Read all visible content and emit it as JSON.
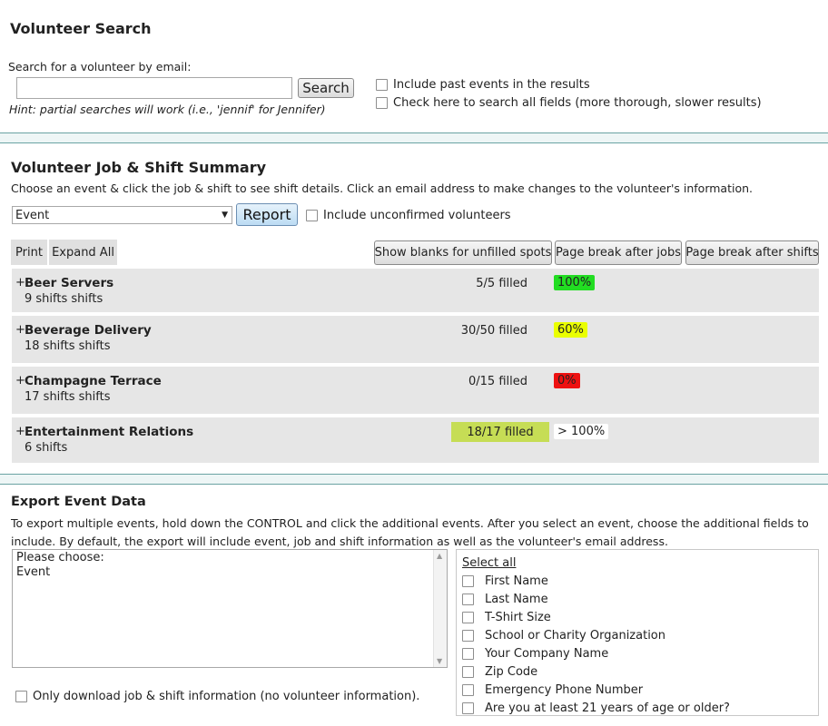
{
  "search": {
    "title": "Volunteer Search",
    "label": "Search for a volunteer by email:",
    "input_value": "",
    "button": "Search",
    "hint": "Hint: partial searches will work (i.e., 'jennif' for Jennifer)",
    "option_past": "Include past events in the results",
    "option_all_fields": "Check here to search all fields (more thorough, slower results)"
  },
  "summary": {
    "title": "Volunteer Job & Shift Summary",
    "instructions": "Choose an event & click the job & shift to see shift details. Click an email address to make changes to the volunteer's information.",
    "event_select": "Event",
    "report_button": "Report",
    "include_unconfirmed": "Include unconfirmed volunteers",
    "print": "Print",
    "expand_all": "Expand All",
    "show_blanks": "Show blanks for unfilled spots",
    "page_break_jobs": "Page break after jobs",
    "page_break_shifts": "Page break after shifts",
    "expander": "+",
    "jobs": [
      {
        "name": "Beer Servers",
        "shifts": "9 shifts shifts",
        "filled": "5/5 filled",
        "pct": "100%",
        "pct_color": "#22dd22"
      },
      {
        "name": "Beverage Delivery",
        "shifts": "18 shifts shifts",
        "filled": "30/50 filled",
        "pct": "60%",
        "pct_color": "#eaff00"
      },
      {
        "name": "Champagne Terrace",
        "shifts": "17 shifts shifts",
        "filled": "0/15 filled",
        "pct": "0%",
        "pct_color": "#ee1111"
      },
      {
        "name": "Entertainment Relations",
        "shifts": "6 shifts",
        "filled": "18/17 filled",
        "pct": "> 100%",
        "pct_color": "#ffffff",
        "filled_bg": "#c6dd55"
      }
    ]
  },
  "export": {
    "title": "Export Event Data",
    "instructions": "To export multiple events, hold down the CONTROL and click the additional events. After you select an event, choose the additional fields to include. By default, the export will include event, job and shift information as well as the volunteer's email address.",
    "events": [
      "Please choose:",
      "Event"
    ],
    "only_download": "Only download job & shift information (no volunteer information).",
    "select_all": "Select all",
    "fields": [
      "First Name",
      "Last Name",
      "T-Shirt Size",
      "School or Charity Organization",
      "Your Company Name",
      "Zip Code",
      "Emergency Phone Number",
      "Are you at least 21 years of age or older?"
    ]
  },
  "colors": {
    "divider": "#6aa3a3",
    "row_bg": "#e6e6e6",
    "accent_blue": "#bcdcf3"
  }
}
